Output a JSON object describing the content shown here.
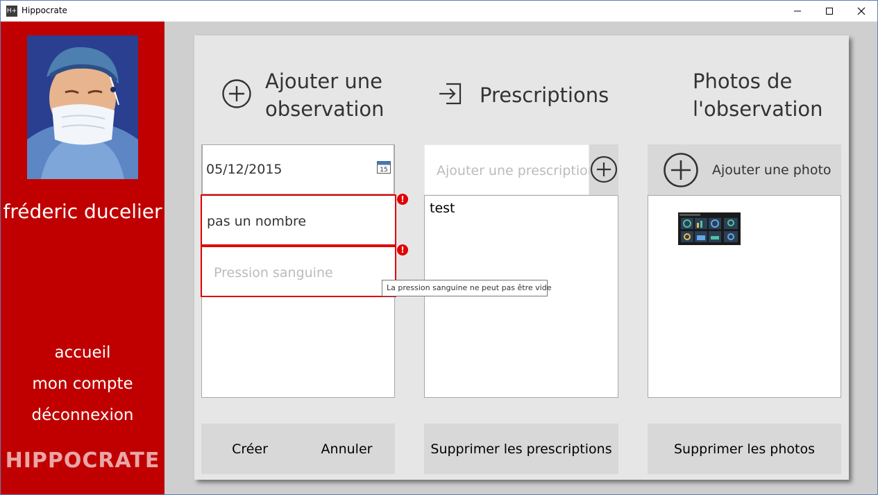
{
  "window": {
    "title": "Hippocrate",
    "icon_text": "H+"
  },
  "sidebar": {
    "user_name": "fréderic ducelier",
    "nav": [
      "accueil",
      "mon compte",
      "déconnexion"
    ],
    "logo": "HIPPOCRATE",
    "bg_color": "#c00000"
  },
  "observation": {
    "header": "Ajouter une observation",
    "header_line1": "Ajouter une",
    "header_line2": "observation",
    "date_value": "05/12/2015",
    "weight_value": "pas un nombre",
    "pressure_placeholder": "Pression sanguine",
    "pressure_error_tooltip": "La pression sanguine ne peut pas être vide",
    "create_label": "Créer",
    "cancel_label": "Annuler"
  },
  "prescriptions": {
    "header": "Prescriptions",
    "input_placeholder": "Ajouter une prescription",
    "items": [
      "test"
    ],
    "delete_label": "Supprimer les prescriptions"
  },
  "photos": {
    "header_line1": "Photos de",
    "header_line2": "l'observation",
    "add_label": "Ajouter une photo",
    "delete_label": "Supprimer les photos"
  },
  "colors": {
    "error": "#e00000",
    "panel": "#e6e6e6",
    "button": "#d8d8d8"
  }
}
